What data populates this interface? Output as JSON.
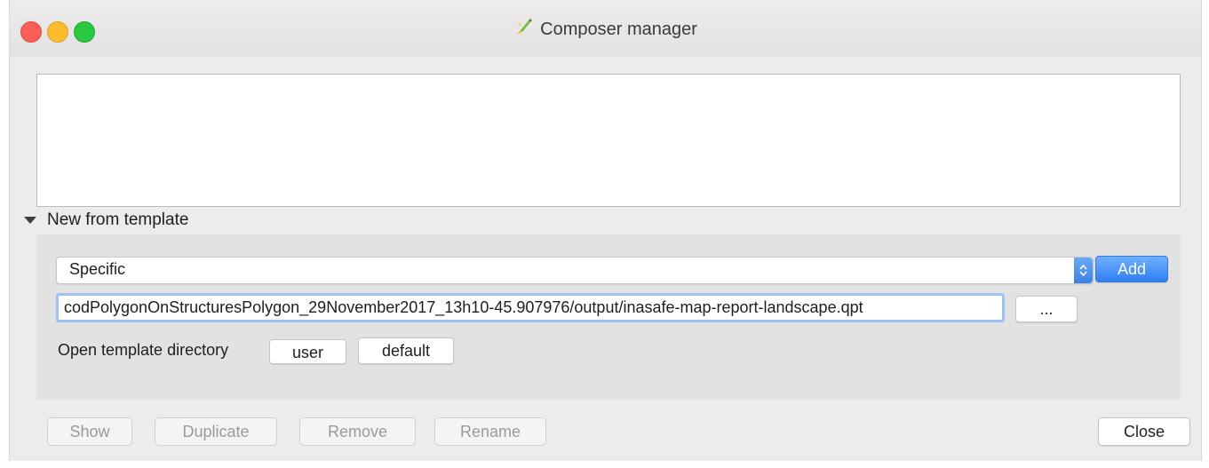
{
  "window": {
    "title": "Composer manager"
  },
  "new_from_template": {
    "section_label": "New from template",
    "template_select": {
      "selected": "Specific"
    },
    "add_label": "Add",
    "template_path": "codPolygonOnStructuresPolygon_29November2017_13h10-45.907976/output/inasafe-map-report-landscape.qpt",
    "browse_label": "...",
    "open_dir_label": "Open template directory",
    "user_label": "user",
    "default_label": "default"
  },
  "actions": {
    "show": "Show",
    "duplicate": "Duplicate",
    "remove": "Remove",
    "rename": "Rename",
    "close": "Close"
  },
  "colors": {
    "accent": "#3a82e6",
    "traffic_red": "#fc5f57",
    "traffic_yellow": "#fdbc2e",
    "traffic_green": "#28c840"
  },
  "icons": {
    "title": "qgis-composer-icon",
    "section": "triangle-down-icon",
    "select": "up-down-chevron-icon"
  }
}
